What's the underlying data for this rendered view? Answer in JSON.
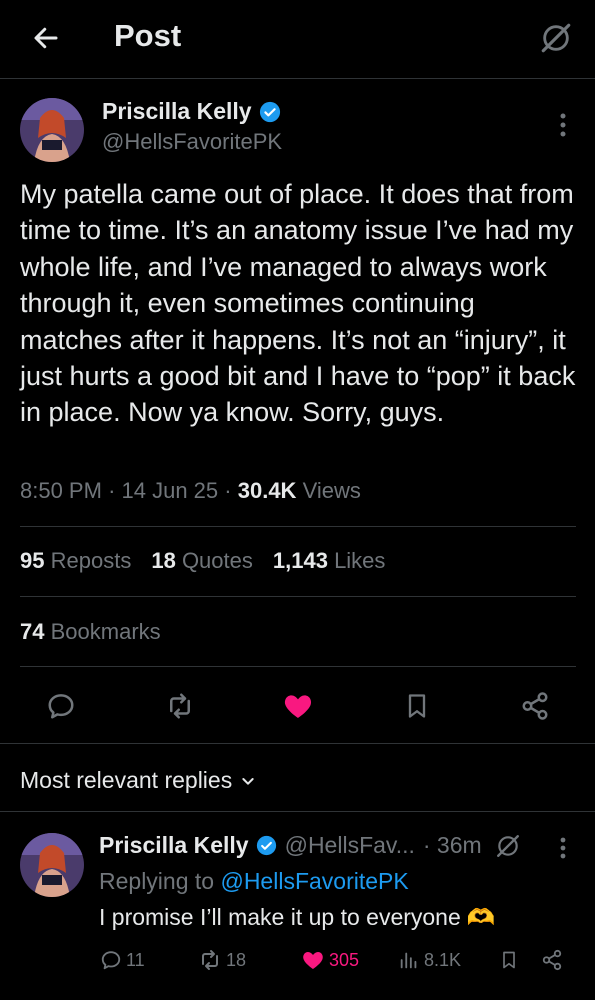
{
  "header": {
    "title": "Post",
    "back_icon": "arrow-left-icon",
    "grok_icon": "grok-icon"
  },
  "post": {
    "author_name": "Priscilla Kelly",
    "author_handle": "@HellsFavoritePK",
    "verified": true,
    "text": "My patella came out of place. It does that from time to time. It’s an anatomy issue I’ve had my whole life, and I’ve managed to always work through it, even sometimes continuing matches after it happens. It’s not an “injury”, it just hurts a good bit and I have to “pop” it back in place. Now ya know. Sorry, guys.",
    "time": "8:50 PM",
    "date": "14 Jun 25",
    "views_count": "30.4K",
    "views_label": "Views",
    "reposts_count": "95",
    "reposts_label": "Reposts",
    "quotes_count": "18",
    "quotes_label": "Quotes",
    "likes_count": "1,143",
    "likes_label": "Likes",
    "bookmarks_count": "74",
    "bookmarks_label": "Bookmarks"
  },
  "replies_section": {
    "label": "Most relevant replies"
  },
  "reply": {
    "author_name": "Priscilla Kelly",
    "author_handle": "@HellsFav...",
    "time": "· 36m",
    "replying_prefix": "Replying to",
    "replying_handle": "@HellsFavoritePK",
    "text": "I promise I’ll make it up to everyone",
    "emoji": "🫶",
    "replies_count": "11",
    "reposts_count": "18",
    "likes_count": "305",
    "views_count": "8.1K"
  },
  "colors": {
    "background": "#000000",
    "text_primary": "#e7e9ea",
    "text_secondary": "#71767b",
    "accent_blue": "#1d9bf0",
    "like_pink": "#f91880",
    "divider": "#2f3336"
  }
}
